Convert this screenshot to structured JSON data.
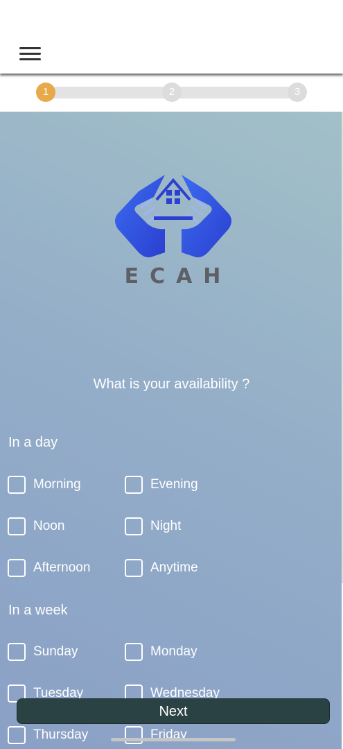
{
  "header": {
    "menu_icon": "hamburger-menu-icon"
  },
  "stepper": {
    "steps": [
      "1",
      "2",
      "3"
    ],
    "active_step": 1
  },
  "logo": {
    "text": "ECAH",
    "icon": "house-in-hands-logo"
  },
  "question": "What is your availability ?",
  "sections": {
    "day": {
      "label": "In a day",
      "options": [
        "Morning",
        "Evening",
        "Noon",
        "Night",
        "Afternoon",
        "Anytime"
      ]
    },
    "week": {
      "label": "In a week",
      "options": [
        "Sunday",
        "Monday",
        "Tuesday",
        "Wednesday",
        "Thursday",
        "Friday"
      ]
    }
  },
  "next_button": "Next",
  "colors": {
    "step_active": "#e8a94a",
    "button_bg": "#2b4244",
    "logo_blue": "#2f54e0",
    "logo_text": "#5f5f66"
  }
}
